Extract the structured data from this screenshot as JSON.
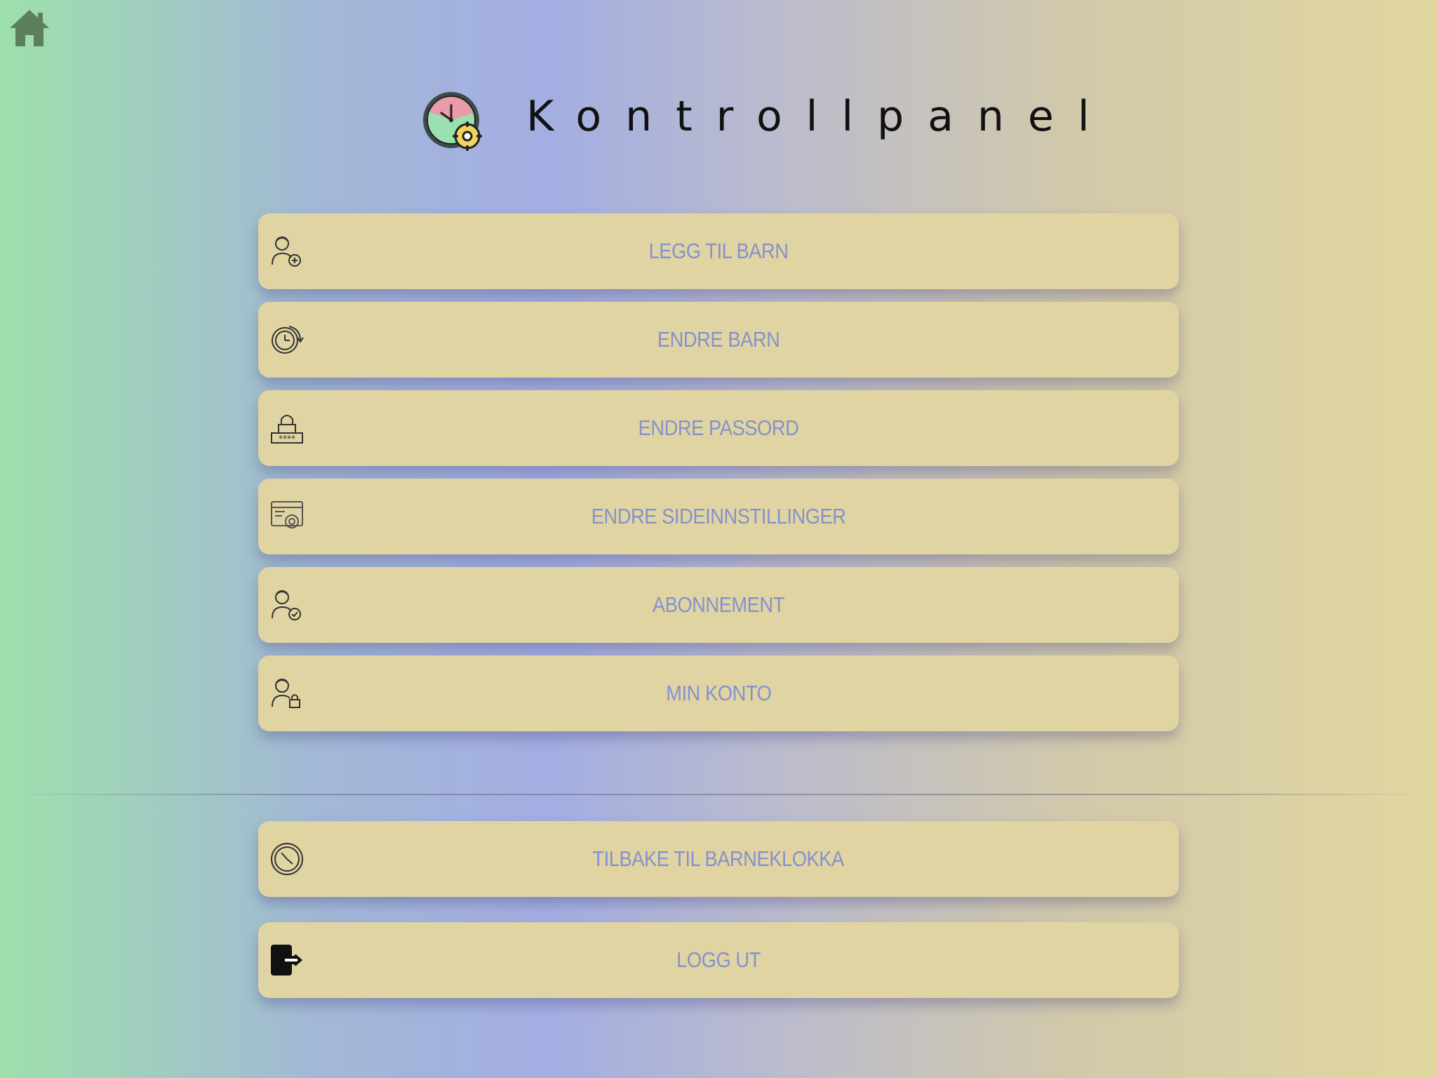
{
  "home": {
    "icon": "home-icon"
  },
  "header": {
    "logo_icon": "clock-settings-logo-icon",
    "title": "Kontrollpanel"
  },
  "menu": {
    "items": [
      {
        "label": "LEGG TIL BARN",
        "icon": "user-add-icon"
      },
      {
        "label": "ENDRE BARN",
        "icon": "clock-rotate-icon"
      },
      {
        "label": "ENDRE PASSORD",
        "icon": "lock-password-icon"
      },
      {
        "label": "ENDRE SIDEINNSTILLINGER",
        "icon": "browser-settings-icon"
      },
      {
        "label": "ABONNEMENT",
        "icon": "user-check-icon"
      },
      {
        "label": "MIN KONTO",
        "icon": "user-lock-icon"
      }
    ]
  },
  "footer_actions": {
    "back": {
      "label": "TILBAKE TIL BARNEKLOKKA",
      "icon": "clock-icon"
    },
    "logout": {
      "label": "LOGG UT",
      "icon": "logout-icon"
    }
  },
  "colors": {
    "button_bg": "#e0d5a2",
    "button_text": "#8590cf",
    "home_icon": "#5e7f5e"
  }
}
